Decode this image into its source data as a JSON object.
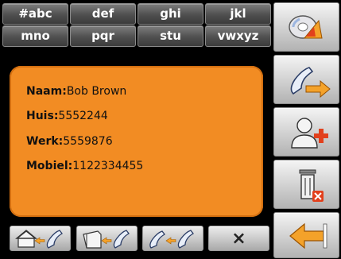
{
  "filter_tabs": [
    "#abc",
    "def",
    "ghi",
    "jkl",
    "mno",
    "pqr",
    "stu",
    "vwxyz"
  ],
  "contact": {
    "name_label": "Naam:",
    "name": "Bob Brown",
    "home_label": "Huis:",
    "home": "5552244",
    "work_label": "Werk:",
    "work": "5559876",
    "mobile_label": "Mobiel:",
    "mobile": "1122334455"
  },
  "actions": {
    "call_home_icon": "house-phone-icon",
    "call_work_icon": "building-phone-icon",
    "call_mobile_icon": "mobile-phone-icon",
    "close_label": "×"
  },
  "side_toolbar": {
    "items": [
      "disc-arrow-icon",
      "phone-transfer-icon",
      "add-contact-icon",
      "delete-contact-icon",
      "back-icon"
    ]
  },
  "colors": {
    "card": "#f28c23",
    "accent_arrow": "#f4a22a",
    "delete_red": "#e2401c",
    "background": "#000000"
  }
}
